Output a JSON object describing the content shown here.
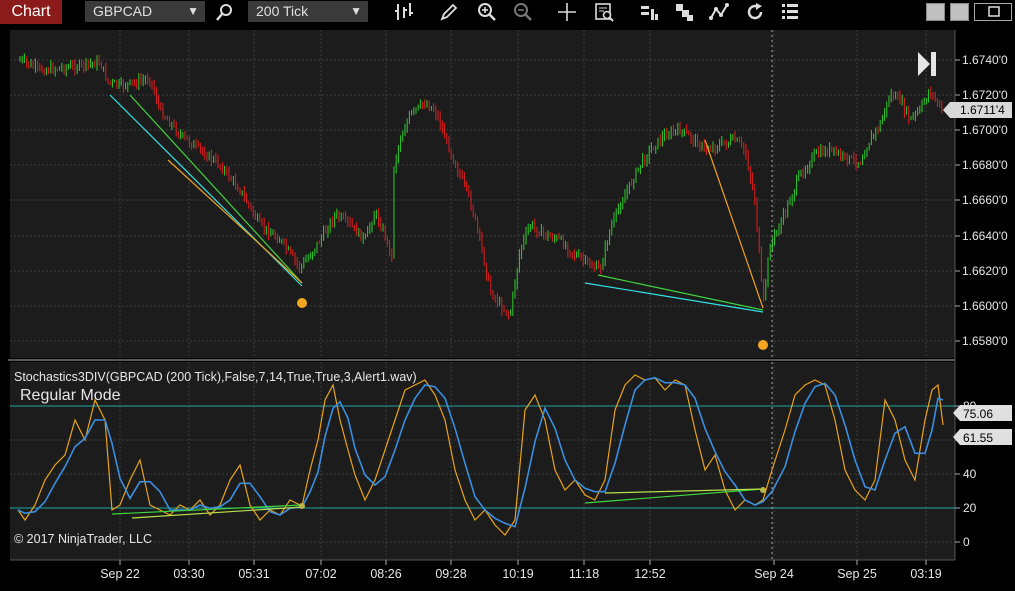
{
  "toolbar": {
    "title": "Chart",
    "instrument": "GBPCAD",
    "interval": "200 Tick",
    "icons": [
      "instrument-search-icon",
      "bar-type-icon",
      "draw-pencil-icon",
      "zoom-in-icon",
      "zoom-out-icon",
      "crosshair-icon",
      "data-box-icon",
      "indicators-icon",
      "strategies-icon",
      "chart-trader-icon",
      "reload-icon",
      "properties-icon"
    ]
  },
  "price_panel": {
    "y_ticks": [
      "1.6740'0",
      "1.6720'0",
      "1.6700'0",
      "1.6680'0",
      "1.6660'0",
      "1.6640'0",
      "1.6620'0",
      "1.6600'0",
      "1.6580'0"
    ],
    "last_price": "1.6711'4",
    "colors": {
      "up": "#2ecc2e",
      "down": "#e01e1e",
      "divergence_cyan": "#33e0e6",
      "divergence_green": "#3fd63f",
      "divergence_orange": "#f0a020",
      "dot": "#f5a623"
    }
  },
  "indicator_panel": {
    "label": "Stochastics3DIV(GBPCAD (200 Tick),False,7,14,True,True,3,Alert1.wav)",
    "mode": "Regular Mode",
    "y_ticks": [
      "80",
      "60",
      "40",
      "20",
      "0"
    ],
    "k_value": "75.06",
    "d_value": "61.55",
    "colors": {
      "k": "#e8a317",
      "d": "#3b8fe0",
      "levels": "#1fa3a3"
    }
  },
  "x_axis": {
    "labels": [
      "Sep 22",
      "03:30",
      "05:31",
      "07:02",
      "08:26",
      "09:28",
      "10:19",
      "11:18",
      "12:52",
      "Sep 24",
      "Sep 25",
      "03:19"
    ]
  },
  "copyright": "© 2017 NinjaTrader, LLC"
}
